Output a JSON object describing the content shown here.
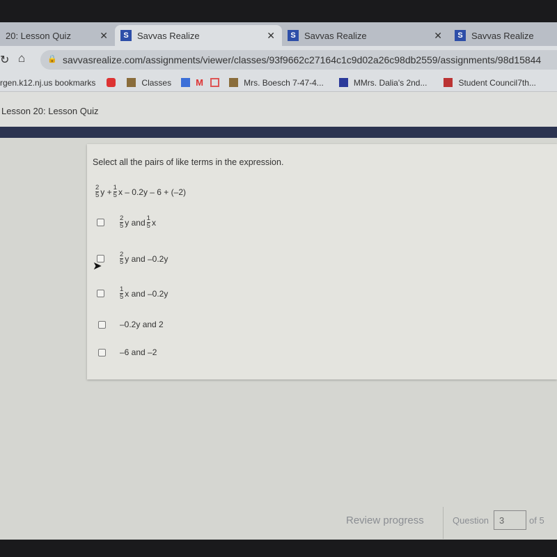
{
  "browser": {
    "tabs": [
      {
        "label": "20: Lesson Quiz"
      },
      {
        "label": "Savvas Realize",
        "active": true
      },
      {
        "label": "Savvas Realize"
      },
      {
        "label": "Savvas Realize"
      }
    ],
    "url": "savvasrealize.com/assignments/viewer/classes/93f9662c27164c1c9d02a26c98db2559/assignments/98d15844",
    "bookmarks": [
      "rgen.k12.nj.us bookmarks",
      "Classes",
      "Mrs. Boesch 7-47-4...",
      "MMrs. Dalia's 2nd...",
      "Student Council7th..."
    ]
  },
  "page": {
    "title": "Lesson 20: Lesson Quiz"
  },
  "question": {
    "prompt": "Select all the pairs of like terms in the expression.",
    "expression": {
      "f1n": "2",
      "f1d": "5",
      "t1": "y +",
      "f2n": "1",
      "f2d": "5",
      "t2": "x – 0.2y – 6 + (–2)"
    },
    "options": [
      {
        "fn": "2",
        "fd": "5",
        "text": "y and",
        "fn2": "1",
        "fd2": "5",
        "text2": "x",
        "checked": false
      },
      {
        "fn": "2",
        "fd": "5",
        "text": "y and –0.2y",
        "checked": false
      },
      {
        "fn": "1",
        "fd": "5",
        "text": "x and –0.2y",
        "checked": false
      },
      {
        "text": "–0.2y and 2",
        "checked": false
      },
      {
        "text": "–6 and –2",
        "checked": false
      }
    ]
  },
  "footer": {
    "review": "Review progress",
    "question_label": "Question",
    "current": "3",
    "of": "of 5"
  },
  "colors": {
    "nav": "#2b3350",
    "brand": "#2d4ea8"
  }
}
